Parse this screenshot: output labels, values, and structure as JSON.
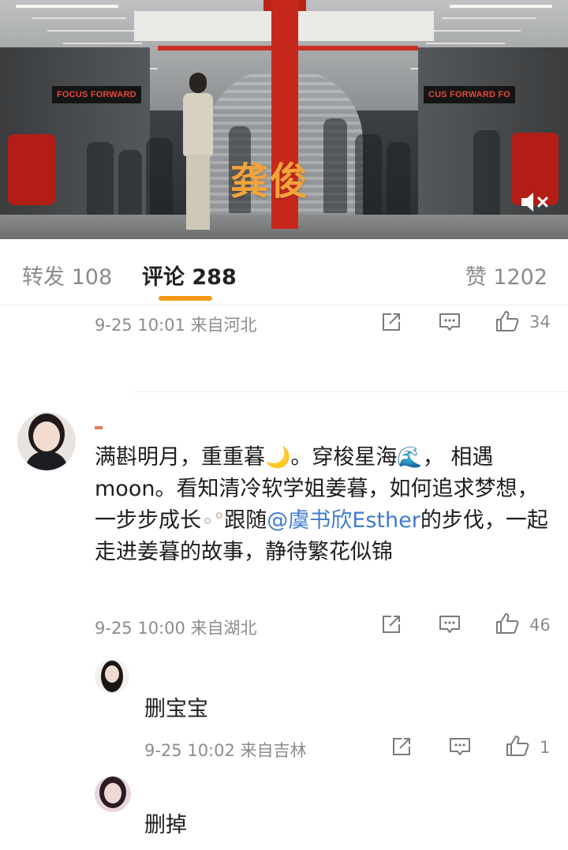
{
  "video": {
    "title": "龚俊",
    "sign_left": "FOCUS FORWARD",
    "sign_right": "CUS FORWARD  FO",
    "mute_icon": "speaker-mute-icon"
  },
  "tabs": {
    "repost": "转发 108",
    "comment": "评论 288",
    "like": "赞 1202"
  },
  "comments": [
    {
      "time_location": "9-25 10:01  来自河北",
      "like_count": "34"
    },
    {
      "username": "",
      "text_part1": "满斟明月，重重暮",
      "moon_emoji": "🌙",
      "text_part2": "。穿梭星海",
      "wave_emoji": "🌊",
      "text_part3": "， 相遇moon。看知清冷软学姐姜暮，如何追求梦想，一步步成长",
      "bubble_emoji": "∘°",
      "text_part4": "跟随",
      "mention": "@虞书欣Esther",
      "text_part5": "的步伐，一起走进姜暮的故事，静待繁花似锦",
      "time_location": "9-25 10:00  来自湖北",
      "like_count": "46",
      "replies": [
        {
          "name": "删宝宝",
          "time_location": "9-25 10:02  来自吉林",
          "like_count": "1"
        },
        {
          "name": "删掉"
        }
      ]
    }
  ],
  "colors": {
    "accent_underline": "#f49a18",
    "mention": "#3f7bd0",
    "pillar_red": "#c7281c",
    "title_orange": "#f2a33a"
  }
}
